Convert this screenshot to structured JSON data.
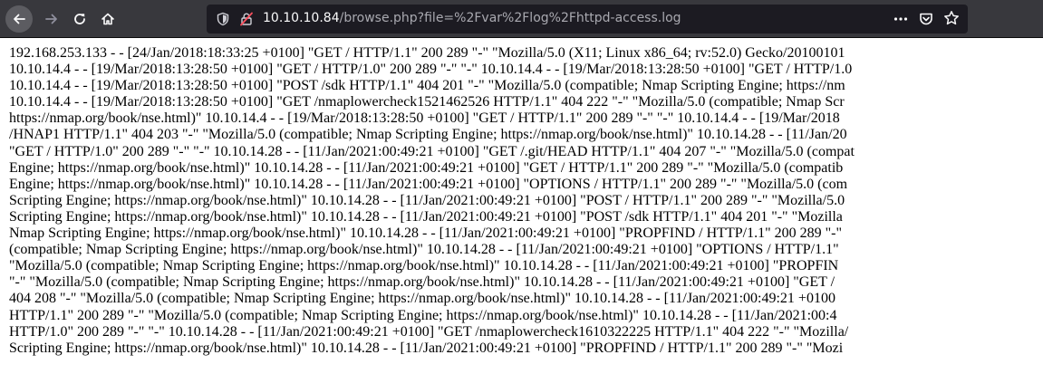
{
  "browser": {
    "url_host": "10.10.10.84",
    "url_path": "/browse.php?file=%2Fvar%2Flog%2Fhttpd-access.log",
    "icons": {
      "back": "arrow-left-icon",
      "forward": "arrow-right-icon",
      "reload": "reload-icon",
      "home": "home-icon",
      "tracking": "shield-icon",
      "insecure": "insecure-lock-icon",
      "menu": "more-icon",
      "pocket": "pocket-icon",
      "bookmark": "star-icon"
    }
  },
  "log_lines": [
    "192.168.253.133 - - [24/Jan/2018:18:33:25 +0100] \"GET / HTTP/1.1\" 200 289 \"-\" \"Mozilla/5.0 (X11; Linux x86_64; rv:52.0) Gecko/20100101",
    "10.10.14.4 - - [19/Mar/2018:13:28:50 +0100] \"GET / HTTP/1.0\" 200 289 \"-\" \"-\" 10.10.14.4 - - [19/Mar/2018:13:28:50 +0100] \"GET / HTTP/1.0",
    "10.10.14.4 - - [19/Mar/2018:13:28:50 +0100] \"POST /sdk HTTP/1.1\" 404 201 \"-\" \"Mozilla/5.0 (compatible; Nmap Scripting Engine; https://nm",
    "10.10.14.4 - - [19/Mar/2018:13:28:50 +0100] \"GET /nmaplowercheck1521462526 HTTP/1.1\" 404 222 \"-\" \"Mozilla/5.0 (compatible; Nmap Scr",
    "https://nmap.org/book/nse.html)\" 10.10.14.4 - - [19/Mar/2018:13:28:50 +0100] \"GET / HTTP/1.1\" 200 289 \"-\" \"-\" 10.10.14.4 - - [19/Mar/2018",
    "/HNAP1 HTTP/1.1\" 404 203 \"-\" \"Mozilla/5.0 (compatible; Nmap Scripting Engine; https://nmap.org/book/nse.html)\" 10.10.14.28 - - [11/Jan/20",
    "\"GET / HTTP/1.0\" 200 289 \"-\" \"-\" 10.10.14.28 - - [11/Jan/2021:00:49:21 +0100] \"GET /.git/HEAD HTTP/1.1\" 404 207 \"-\" \"Mozilla/5.0 (compat",
    "Engine; https://nmap.org/book/nse.html)\" 10.10.14.28 - - [11/Jan/2021:00:49:21 +0100] \"GET / HTTP/1.1\" 200 289 \"-\" \"Mozilla/5.0 (compatib",
    "Engine; https://nmap.org/book/nse.html)\" 10.10.14.28 - - [11/Jan/2021:00:49:21 +0100] \"OPTIONS / HTTP/1.1\" 200 289 \"-\" \"Mozilla/5.0 (com",
    "Scripting Engine; https://nmap.org/book/nse.html)\" 10.10.14.28 - - [11/Jan/2021:00:49:21 +0100] \"POST / HTTP/1.1\" 200 289 \"-\" \"Mozilla/5.0",
    "Scripting Engine; https://nmap.org/book/nse.html)\" 10.10.14.28 - - [11/Jan/2021:00:49:21 +0100] \"POST /sdk HTTP/1.1\" 404 201 \"-\" \"Mozilla",
    "Nmap Scripting Engine; https://nmap.org/book/nse.html)\" 10.10.14.28 - - [11/Jan/2021:00:49:21 +0100] \"PROPFIND / HTTP/1.1\" 200 289 \"-\"",
    "(compatible; Nmap Scripting Engine; https://nmap.org/book/nse.html)\" 10.10.14.28 - - [11/Jan/2021:00:49:21 +0100] \"OPTIONS / HTTP/1.1\"",
    "\"Mozilla/5.0 (compatible; Nmap Scripting Engine; https://nmap.org/book/nse.html)\" 10.10.14.28 - - [11/Jan/2021:00:49:21 +0100] \"PROPFIN",
    "\"-\" \"Mozilla/5.0 (compatible; Nmap Scripting Engine; https://nmap.org/book/nse.html)\" 10.10.14.28 - - [11/Jan/2021:00:49:21 +0100] \"GET /",
    "404 208 \"-\" \"Mozilla/5.0 (compatible; Nmap Scripting Engine; https://nmap.org/book/nse.html)\" 10.10.14.28 - - [11/Jan/2021:00:49:21 +0100",
    "HTTP/1.1\" 200 289 \"-\" \"Mozilla/5.0 (compatible; Nmap Scripting Engine; https://nmap.org/book/nse.html)\" 10.10.14.28 - - [11/Jan/2021:00:4",
    "HTTP/1.0\" 200 289 \"-\" \"-\" 10.10.14.28 - - [11/Jan/2021:00:49:21 +0100] \"GET /nmaplowercheck1610322225 HTTP/1.1\" 404 222 \"-\" \"Mozilla/",
    "Scripting Engine; https://nmap.org/book/nse.html)\" 10.10.14.28 - - [11/Jan/2021:00:49:21 +0100] \"PROPFIND / HTTP/1.1\" 200 289 \"-\" \"Mozi"
  ]
}
